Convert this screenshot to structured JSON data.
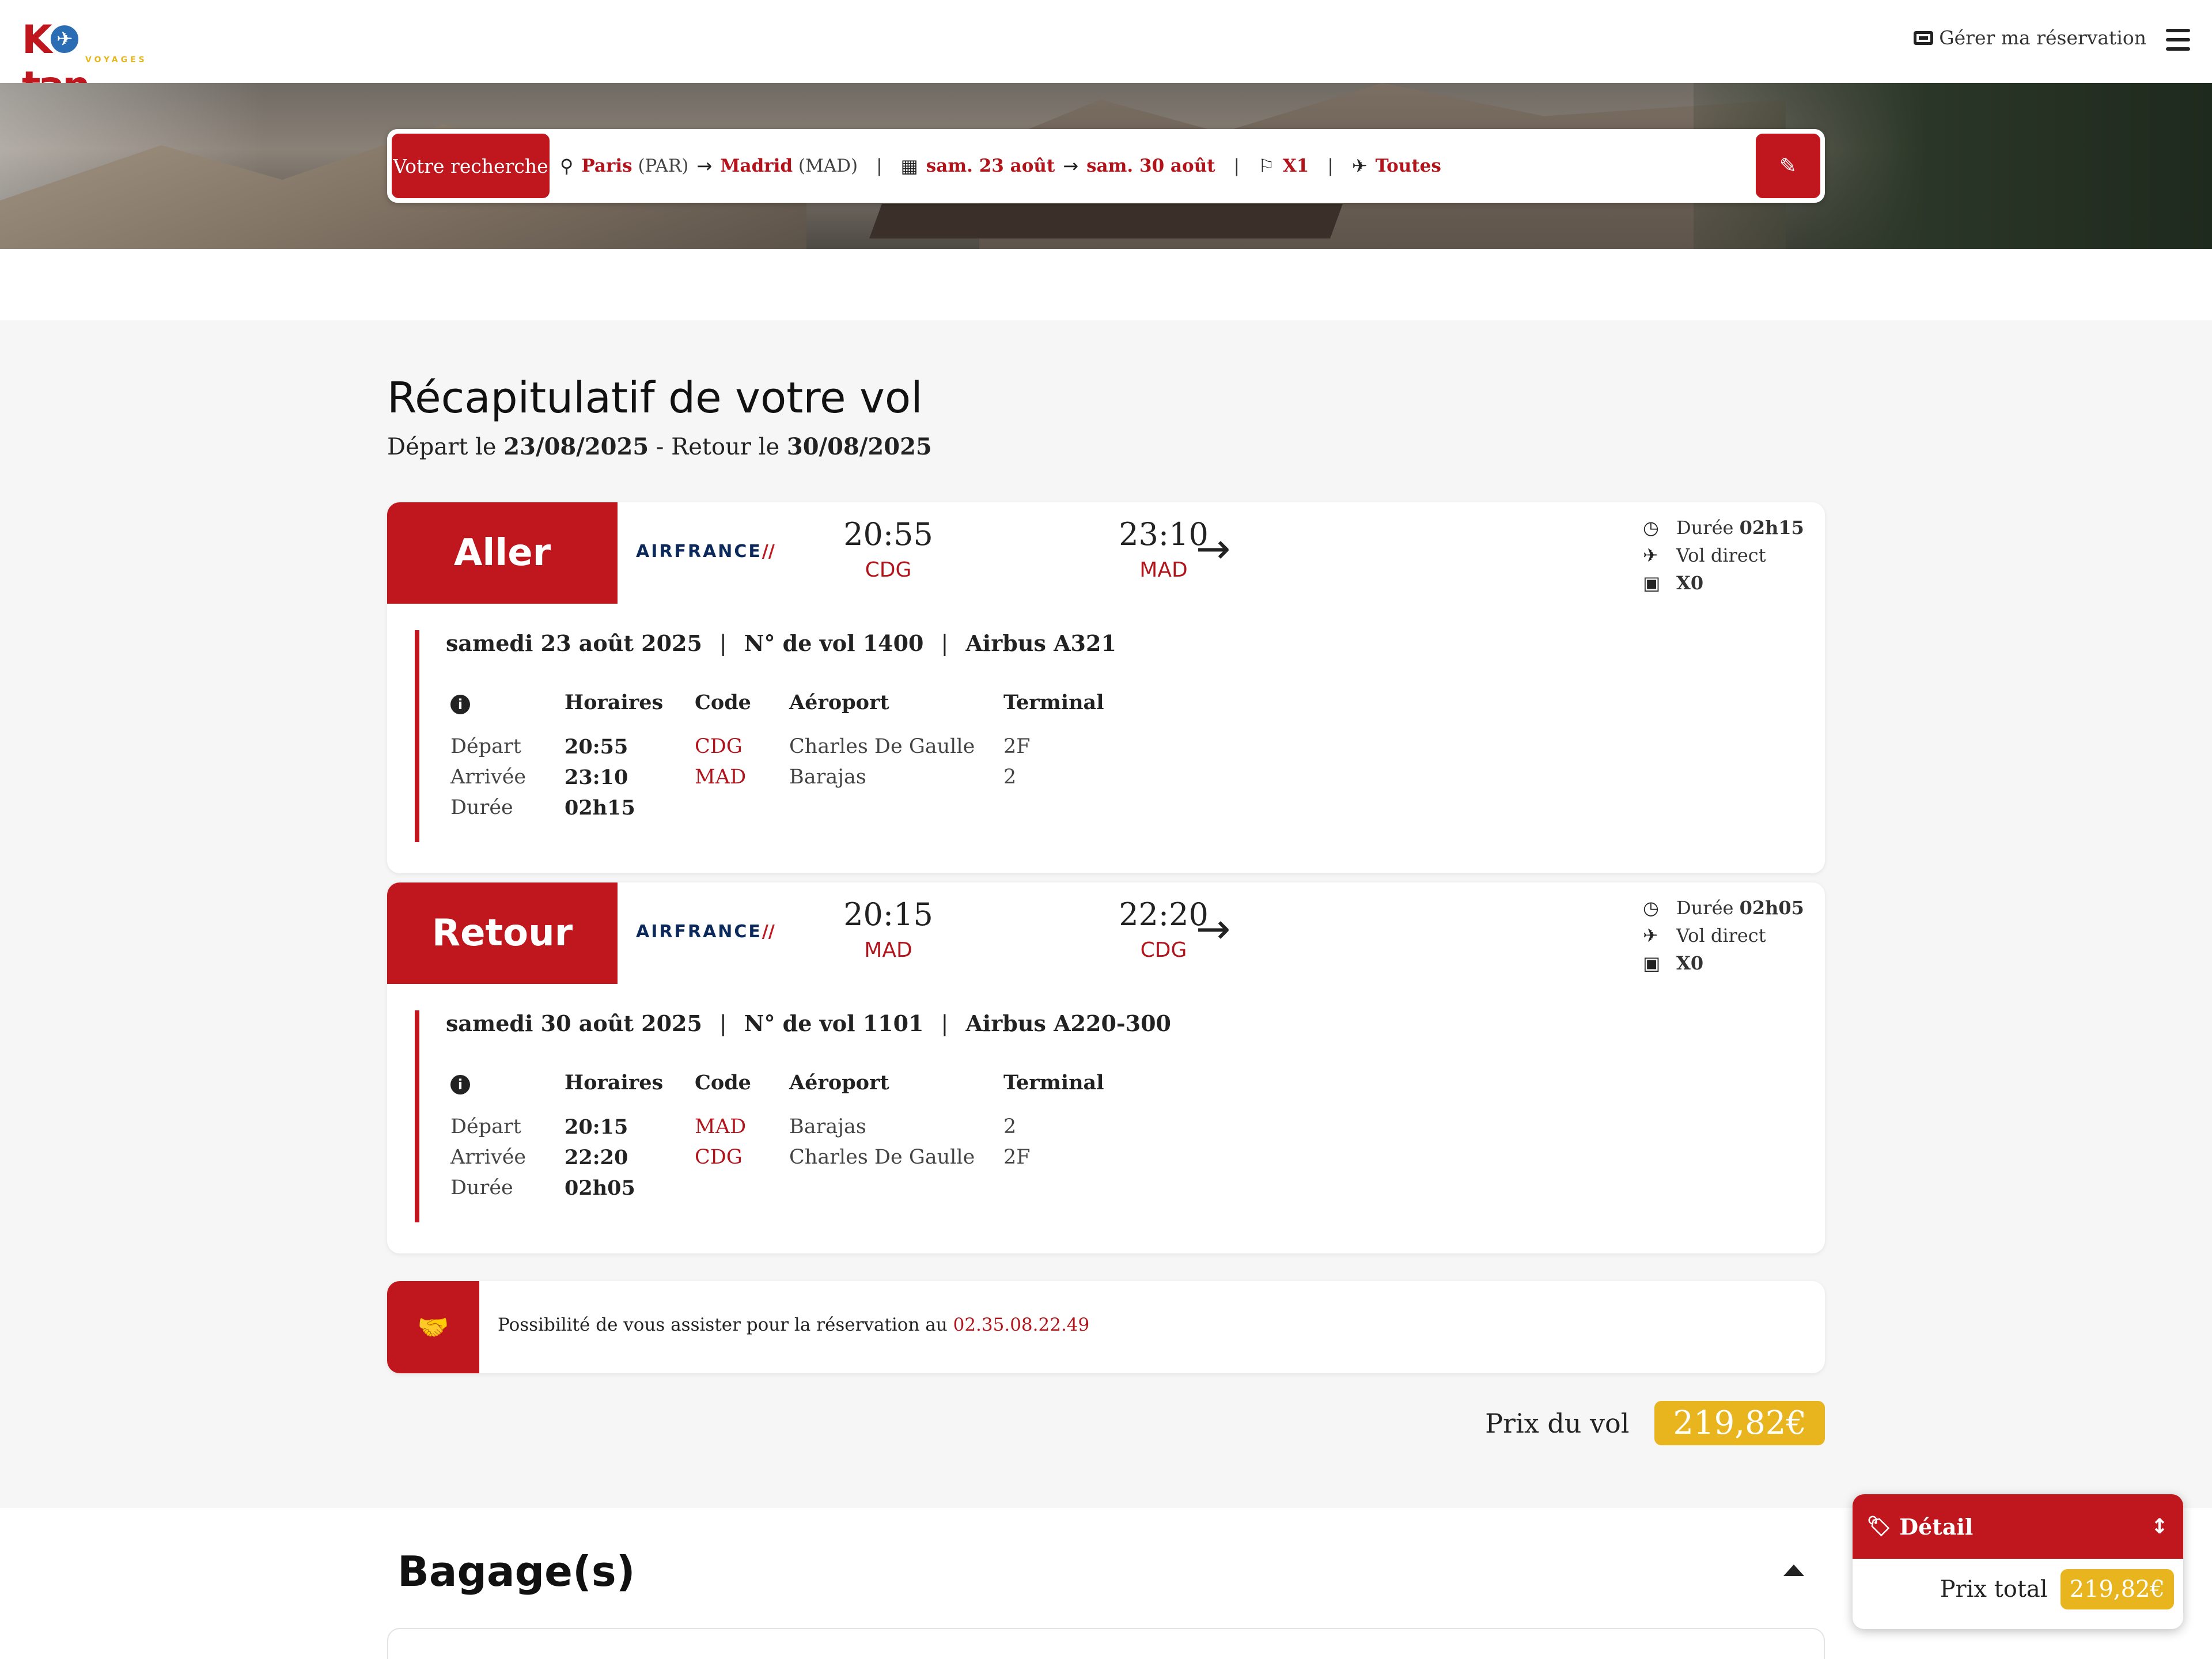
{
  "header": {
    "logo_text": "K tan",
    "logo_sub": "VOYAGES",
    "manage_label": "Gérer ma réservation"
  },
  "search": {
    "tag": "Votre recherche",
    "from_city": "Paris",
    "from_code": "(PAR)",
    "to_city": "Madrid",
    "to_code": "(MAD)",
    "date_out": "sam. 23 août",
    "date_back": "sam. 30 août",
    "passengers": "X1",
    "airlines": "Toutes"
  },
  "recap": {
    "title": "Récapitulatif de votre vol",
    "depart_prefix": "Départ le",
    "depart_date": "23/08/2025",
    "return_prefix": "- Retour le",
    "return_date": "30/08/2025"
  },
  "legs": [
    {
      "label": "Aller",
      "airline": "AIRFRANCE",
      "dep_time": "20:55",
      "dep_code": "CDG",
      "arr_time": "23:10",
      "arr_code": "MAD",
      "duration_prefix": "Durée",
      "duration": "02h15",
      "direct": "Vol direct",
      "bags": "X0",
      "date_long": "samedi 23 août 2025",
      "flight_no": "N° de vol 1400",
      "aircraft": "Airbus A321",
      "table": {
        "headers": [
          "Horaires",
          "Code",
          "Aéroport",
          "Terminal"
        ],
        "row_labels": [
          "Départ",
          "Arrivée",
          "Durée"
        ],
        "times": [
          "20:55",
          "23:10",
          "02h15"
        ],
        "codes": [
          "CDG",
          "MAD"
        ],
        "airports": [
          "Charles De Gaulle",
          "Barajas"
        ],
        "terminals": [
          "2F",
          "2"
        ]
      }
    },
    {
      "label": "Retour",
      "airline": "AIRFRANCE",
      "dep_time": "20:15",
      "dep_code": "MAD",
      "arr_time": "22:20",
      "arr_code": "CDG",
      "duration_prefix": "Durée",
      "duration": "02h05",
      "direct": "Vol direct",
      "bags": "X0",
      "date_long": "samedi 30 août 2025",
      "flight_no": "N° de vol 1101",
      "aircraft": "Airbus A220-300",
      "table": {
        "headers": [
          "Horaires",
          "Code",
          "Aéroport",
          "Terminal"
        ],
        "row_labels": [
          "Départ",
          "Arrivée",
          "Durée"
        ],
        "times": [
          "20:15",
          "22:20",
          "02h05"
        ],
        "codes": [
          "MAD",
          "CDG"
        ],
        "airports": [
          "Barajas",
          "Charles De Gaulle"
        ],
        "terminals": [
          "2",
          "2F"
        ]
      }
    }
  ],
  "assist": {
    "text": "Possibilité de vous assister pour la réservation au",
    "phone": "02.35.08.22.49"
  },
  "price": {
    "label": "Prix du vol",
    "value": "219,82€"
  },
  "baggage": {
    "title": "Bagage(s)"
  },
  "float_panel": {
    "title": "Détail",
    "total_label": "Prix total",
    "total_value": "219,82€"
  },
  "colors": {
    "brand_red": "#c0171e",
    "price_yellow": "#e8b51f"
  }
}
